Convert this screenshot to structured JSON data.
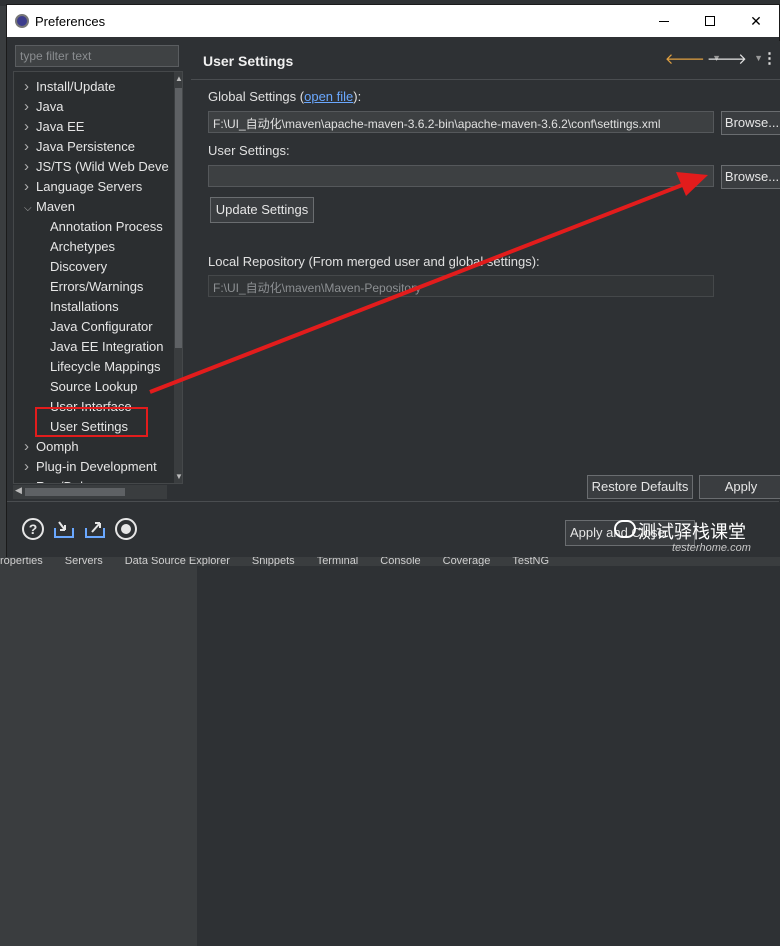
{
  "window": {
    "title": "Preferences",
    "controls": {
      "minimize": "",
      "maximize": "",
      "close": "✕"
    }
  },
  "sidebar": {
    "filter_placeholder": "type filter text",
    "items": [
      {
        "label": "Install/Update",
        "expandable": true,
        "expanded": false,
        "level": 0
      },
      {
        "label": "Java",
        "expandable": true,
        "expanded": false,
        "level": 0
      },
      {
        "label": "Java EE",
        "expandable": true,
        "expanded": false,
        "level": 0
      },
      {
        "label": "Java Persistence",
        "expandable": true,
        "expanded": false,
        "level": 0
      },
      {
        "label": "JS/TS (Wild Web Deve",
        "expandable": true,
        "expanded": false,
        "level": 0
      },
      {
        "label": "Language Servers",
        "expandable": true,
        "expanded": false,
        "level": 0
      },
      {
        "label": "Maven",
        "expandable": true,
        "expanded": true,
        "level": 0
      },
      {
        "label": "Annotation Process",
        "level": 1
      },
      {
        "label": "Archetypes",
        "level": 1
      },
      {
        "label": "Discovery",
        "level": 1
      },
      {
        "label": "Errors/Warnings",
        "level": 1
      },
      {
        "label": "Installations",
        "level": 1
      },
      {
        "label": "Java Configurator",
        "level": 1
      },
      {
        "label": "Java EE Integration",
        "level": 1
      },
      {
        "label": "Lifecycle Mappings",
        "level": 1
      },
      {
        "label": "Source Lookup",
        "level": 1
      },
      {
        "label": "User Interface",
        "level": 1
      },
      {
        "label": "User Settings",
        "level": 1,
        "selected": true
      },
      {
        "label": "Oomph",
        "expandable": true,
        "expanded": false,
        "level": 0
      },
      {
        "label": "Plug-in Development",
        "expandable": true,
        "expanded": false,
        "level": 0
      },
      {
        "label": "Run/Debug",
        "expandable": true,
        "expanded": false,
        "level": 0
      }
    ]
  },
  "main": {
    "title": "User Settings",
    "global_settings_label": "Global Settings (",
    "global_settings_link": "open file",
    "global_settings_label_end": "):",
    "global_settings_value": "F:\\UI_自动化\\maven\\apache-maven-3.6.2-bin\\apache-maven-3.6.2\\conf\\settings.xml",
    "browse_global": "Browse...",
    "user_settings_label": "User Settings:",
    "user_settings_value": "",
    "browse_user": "Browse...",
    "update_settings": "Update Settings",
    "local_repo_label": "Local Repository (From merged user and global settings):",
    "local_repo_value": "F:\\UI_自动化\\maven\\Maven-Pepository",
    "restore_defaults": "Restore Defaults",
    "apply": "Apply"
  },
  "footer": {
    "apply_and_close": "Apply and Close",
    "icons": [
      "help-icon",
      "import-icon",
      "export-icon",
      "record-icon"
    ]
  },
  "watermark": {
    "text": "测试驿栈课堂",
    "sub": "testerhome.com"
  },
  "taskbar": {
    "items": [
      "roperties",
      "Servers",
      "Data Source Explorer",
      "Snippets",
      "Terminal",
      "Console",
      "Coverage",
      "TestNG"
    ]
  },
  "colors": {
    "annotation_red": "#e21c1c",
    "link": "#6aa8ff",
    "background": "#2e3134"
  }
}
